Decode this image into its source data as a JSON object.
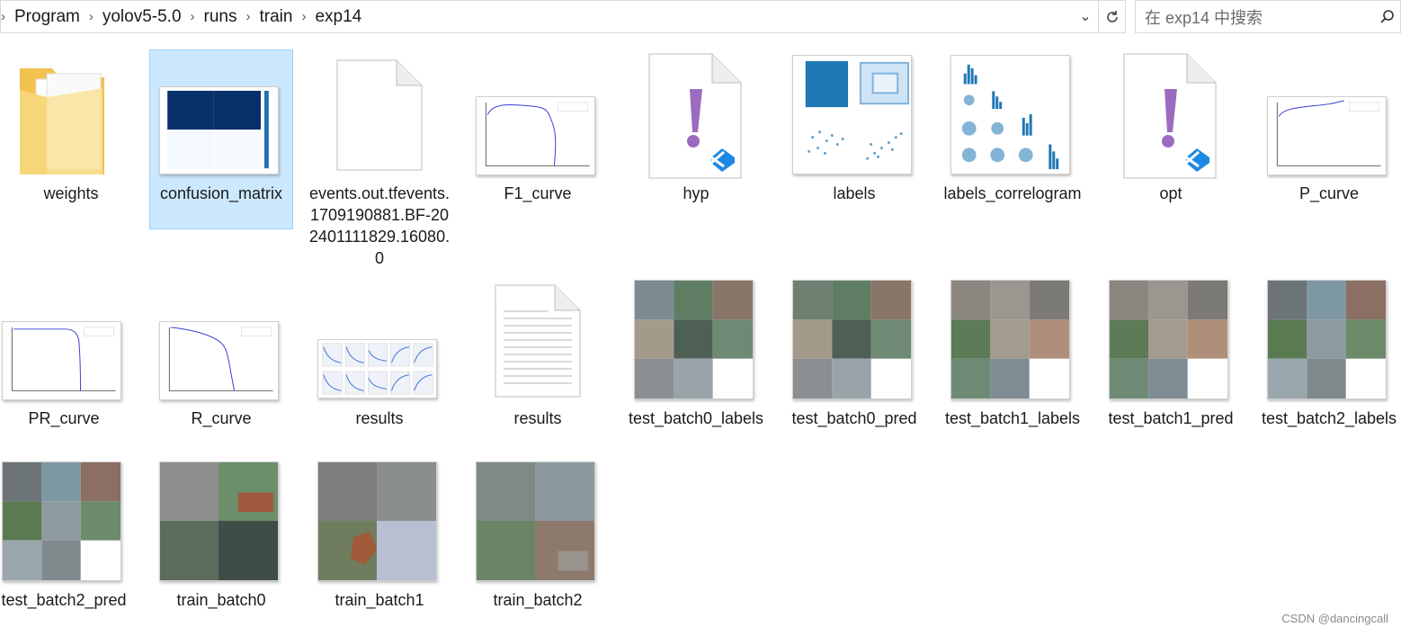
{
  "breadcrumb": [
    "Program",
    "yolov5-5.0",
    "runs",
    "train",
    "exp14"
  ],
  "search": {
    "placeholder": "在 exp14 中搜索"
  },
  "files": [
    {
      "label": "weights"
    },
    {
      "label": "confusion_matrix"
    },
    {
      "label": "events.out.tfevents.1709190881.BF-202401111829.16080.0"
    },
    {
      "label": "F1_curve"
    },
    {
      "label": "hyp"
    },
    {
      "label": "labels"
    },
    {
      "label": "labels_correlogram"
    },
    {
      "label": "opt"
    },
    {
      "label": "P_curve"
    },
    {
      "label": "PR_curve"
    },
    {
      "label": "R_curve"
    },
    {
      "label": "results"
    },
    {
      "label": "results"
    },
    {
      "label": "test_batch0_labels"
    },
    {
      "label": "test_batch0_pred"
    },
    {
      "label": "test_batch1_labels"
    },
    {
      "label": "test_batch1_pred"
    },
    {
      "label": "test_batch2_labels"
    },
    {
      "label": "test_batch2_pred"
    },
    {
      "label": "train_batch0"
    },
    {
      "label": "train_batch1"
    },
    {
      "label": "train_batch2"
    }
  ],
  "watermark": "CSDN @dancingcall",
  "colors": {
    "selection": "#cce8ff",
    "vscode": "#9b6bc0",
    "plot_line": "#3b3bd6"
  }
}
